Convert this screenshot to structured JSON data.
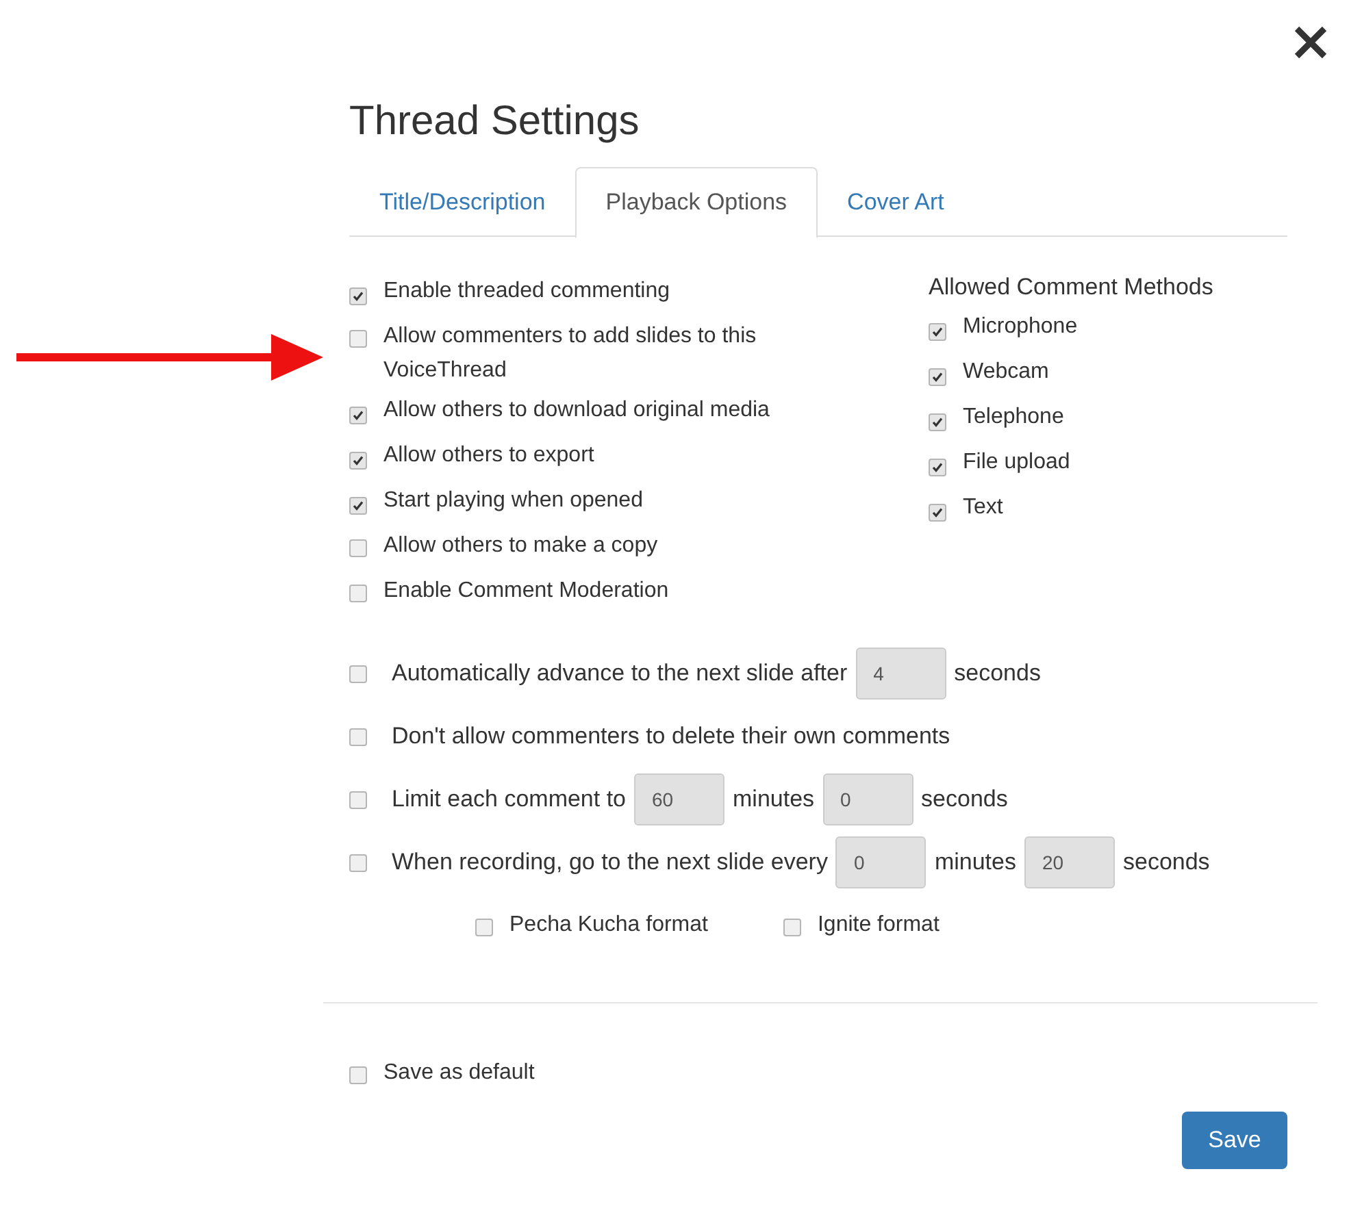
{
  "title": "Thread Settings",
  "tabs": [
    {
      "label": "Title/Description",
      "selected": false
    },
    {
      "label": "Playback Options",
      "selected": true
    },
    {
      "label": "Cover Art",
      "selected": false
    }
  ],
  "options": [
    {
      "label": "Enable threaded commenting",
      "checked": true
    },
    {
      "label": "Allow commenters to add slides to this VoiceThread",
      "checked": false
    },
    {
      "label": "Allow others to download original media",
      "checked": true
    },
    {
      "label": "Allow others to export",
      "checked": true
    },
    {
      "label": "Start playing when opened",
      "checked": true
    },
    {
      "label": "Allow others to make a copy",
      "checked": false
    },
    {
      "label": "Enable Comment Moderation",
      "checked": false
    }
  ],
  "comment_methods": {
    "heading": "Allowed Comment Methods",
    "items": [
      {
        "label": "Microphone",
        "checked": true
      },
      {
        "label": "Webcam",
        "checked": true
      },
      {
        "label": "Telephone",
        "checked": true
      },
      {
        "label": "File upload",
        "checked": true
      },
      {
        "label": "Text",
        "checked": true
      }
    ]
  },
  "timed_options": [
    {
      "checked": false,
      "parts": [
        {
          "kind": "text",
          "text": "Automatically advance to the next slide after"
        },
        {
          "kind": "input",
          "value": "4"
        },
        {
          "kind": "text",
          "text": "seconds"
        }
      ]
    },
    {
      "checked": false,
      "parts": [
        {
          "kind": "text",
          "text": "Don't allow commenters to delete their own comments"
        }
      ]
    },
    {
      "checked": false,
      "parts": [
        {
          "kind": "text",
          "text": "Limit each comment to"
        },
        {
          "kind": "input",
          "value": "60"
        },
        {
          "kind": "text",
          "text": "minutes"
        },
        {
          "kind": "input",
          "value": "0"
        },
        {
          "kind": "text",
          "text": "seconds"
        }
      ]
    },
    {
      "checked": false,
      "parts": [
        {
          "kind": "text",
          "text": "When recording, go to the next slide every"
        },
        {
          "kind": "input",
          "value": "0"
        },
        {
          "kind": "text",
          "text": "minutes"
        },
        {
          "kind": "input",
          "value": "20"
        },
        {
          "kind": "text",
          "text": "seconds"
        }
      ]
    }
  ],
  "formats": [
    {
      "label": "Pecha Kucha format",
      "checked": false
    },
    {
      "label": "Ignite format",
      "checked": false
    }
  ],
  "save_default": {
    "label": "Save as default",
    "checked": false
  },
  "save_button": "Save"
}
